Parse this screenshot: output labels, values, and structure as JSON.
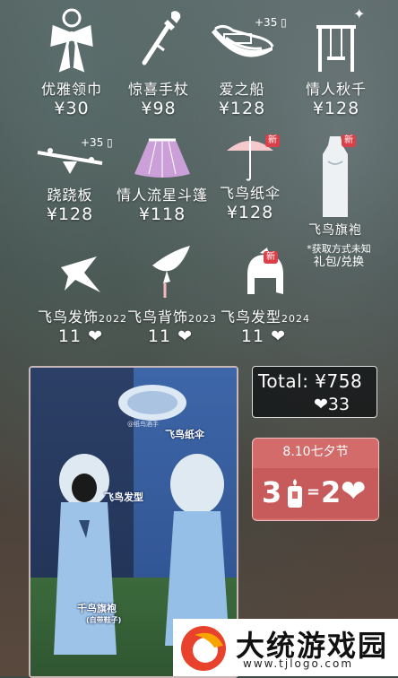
{
  "items": [
    {
      "id": "bow",
      "name": "优雅领巾",
      "price": "¥30"
    },
    {
      "id": "wand",
      "name": "惊喜手杖",
      "price": "¥98"
    },
    {
      "id": "boat",
      "name": "爱之船",
      "price": "¥128",
      "extra": "+35"
    },
    {
      "id": "swing",
      "name": "情人秋千",
      "price": "¥128"
    },
    {
      "id": "seesaw",
      "name": "跷跷板",
      "price": "¥128",
      "extra": "+35"
    },
    {
      "id": "cape",
      "name": "情人流星斗篷",
      "price": "¥118"
    },
    {
      "id": "umbrella",
      "name": "飞鸟纸伞",
      "price": "¥128",
      "badge": "新"
    },
    {
      "id": "robe",
      "name": "飞鸟旗袍",
      "badge": "新",
      "note1": "*获取方式未知",
      "note2": "礼包/兑换"
    },
    {
      "id": "bird-hair-acc",
      "name": "飞鸟发饰",
      "year": "2022",
      "price": "11"
    },
    {
      "id": "bird-back",
      "name": "飞鸟背饰",
      "year": "2023",
      "price": "11"
    },
    {
      "id": "bird-hair",
      "name": "飞鸟发型",
      "year": "2024",
      "price": "11",
      "badge": "新"
    }
  ],
  "photo": {
    "labels": {
      "umbrella": "飞鸟纸伞",
      "hair": "飞鸟发型",
      "robe": "千鸟旗袍",
      "robe_sub": "(自带鞋子)"
    },
    "watermark": "@纸鸟酒手"
  },
  "total": {
    "label": "Total: ¥758",
    "hearts": "33"
  },
  "festival": {
    "title": "8.10七夕节",
    "left": "3",
    "eq": "=",
    "right": "2"
  },
  "logo": {
    "brand": "大统游戏园",
    "site": "www.tjlogo.com"
  },
  "colors": {
    "festival": "#d26b6a",
    "new_badge": "#d9404a",
    "heart": "#ffffff"
  }
}
